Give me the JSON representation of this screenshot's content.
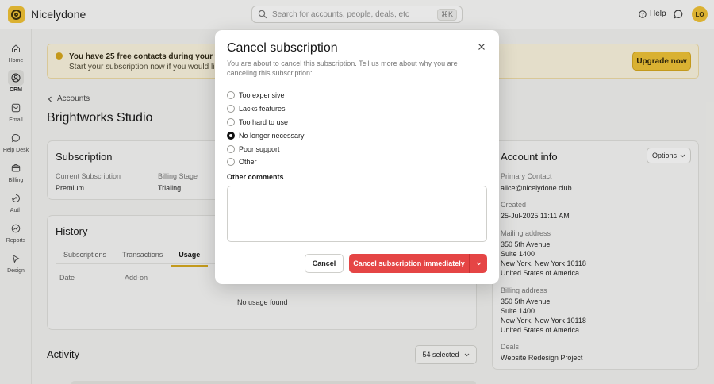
{
  "app": {
    "name": "Nicelydone",
    "logo_icon": "nicelydone-logo-icon"
  },
  "search": {
    "placeholder": "Search for accounts, people, deals, etc",
    "shortcut": "⌘K"
  },
  "header": {
    "help_label": "Help",
    "avatar_initials": "LO"
  },
  "sidebar": {
    "items": [
      {
        "label": "Home",
        "icon": "home-icon",
        "active": false
      },
      {
        "label": "CRM",
        "icon": "crm-icon",
        "active": true
      },
      {
        "label": "Email",
        "icon": "email-icon",
        "active": false
      },
      {
        "label": "Help Desk",
        "icon": "help-desk-icon",
        "active": false
      },
      {
        "label": "Billing",
        "icon": "billing-icon",
        "active": false
      },
      {
        "label": "Auth",
        "icon": "auth-icon",
        "active": false
      },
      {
        "label": "Reports",
        "icon": "reports-icon",
        "active": false
      },
      {
        "label": "Design",
        "icon": "design-icon",
        "active": false
      }
    ]
  },
  "banner": {
    "line1": "You have 25 free contacts during your free trial",
    "line2": "Start your subscription now if you would like to u",
    "upgrade_label": "Upgrade now"
  },
  "breadcrumb": {
    "label": "Accounts"
  },
  "page": {
    "title": "Brightworks Studio"
  },
  "subscription": {
    "title": "Subscription",
    "current_label": "Current Subscription",
    "current_value": "Premium",
    "stage_label": "Billing Stage",
    "stage_value": "Trialing"
  },
  "history": {
    "title": "History",
    "tabs": [
      "Subscriptions",
      "Transactions",
      "Usage"
    ],
    "active_tab": "Usage",
    "columns": [
      "Date",
      "Add-on"
    ],
    "empty_text": "No usage found"
  },
  "account_info": {
    "title": "Account info",
    "options_label": "Options",
    "primary_contact_label": "Primary Contact",
    "primary_contact_value": "alice@nicelydone.club",
    "created_label": "Created",
    "created_value": "25-Jul-2025 11:11 AM",
    "mailing_label": "Mailing address",
    "mailing_lines": [
      "350 5th Avenue",
      "Suite 1400",
      "New York, New York  10118",
      "United States of America"
    ],
    "billing_label": "Billing address",
    "billing_lines": [
      "350 5th Avenue",
      "Suite 1400",
      "New York, New York  10118",
      "United States of America"
    ],
    "deals_label": "Deals",
    "deals_value": "Website Redesign Project"
  },
  "activity": {
    "title": "Activity",
    "selected_label": "54 selected"
  },
  "modal": {
    "title": "Cancel subscription",
    "description": "You are about to cancel this subscription. Tell us more about why you are canceling this subscription:",
    "reasons": [
      "Too expensive",
      "Lacks features",
      "Too hard to use",
      "No longer necessary",
      "Poor support",
      "Other"
    ],
    "selected_reason": "No longer necessary",
    "comments_label": "Other comments",
    "comments_value": "",
    "cancel_label": "Cancel",
    "confirm_label": "Cancel subscription immediately"
  },
  "colors": {
    "accent": "#f0c232",
    "danger": "#e54545",
    "banner_bg": "#fcf5de"
  }
}
